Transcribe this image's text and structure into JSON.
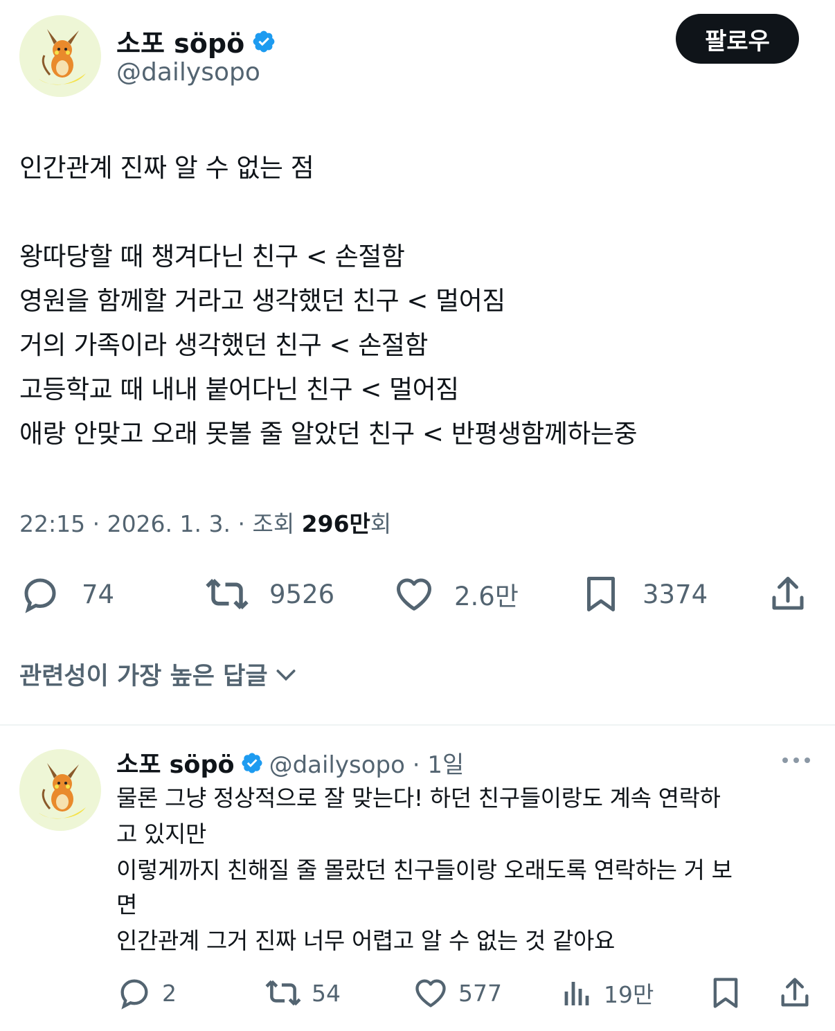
{
  "author": {
    "name": "소포 söpö",
    "handle": "@dailysopo",
    "avatar_icon": "raichu-avatar-icon",
    "verified_icon": "verified-badge-icon"
  },
  "follow_button": {
    "label": "팔로우"
  },
  "tweet": {
    "lines": [
      "인간관계 진짜 알 수 없는 점",
      "왕따당할 때 챙겨다닌 친구 < 손절함",
      "영원을 함께할 거라고 생각했던 친구 < 멀어짐",
      "거의 가족이라 생각했던 친구 < 손절함",
      "고등학교 때 내내 붙어다닌 친구 < 멀어짐",
      "애랑 안맞고 오래 못볼 줄 알았던 친구 < 반평생함께하는중"
    ],
    "time": "22:15 · 2026. 1. 3. · 조회 ",
    "views_bold": "296만",
    "views_suffix": "회"
  },
  "actions": {
    "replies": "74",
    "retweets": "9526",
    "likes": "2.6만",
    "bookmarks": "3374"
  },
  "sort": {
    "label": "관련성이 가장 높은 답글"
  },
  "reply": {
    "name": "소포 söpö",
    "handle_time": "@dailysopo · 1일",
    "lines": [
      "물론 그냥 정상적으로 잘 맞는다! 하던 친구들이랑도 계속 연락하",
      "고 있지만",
      "이렇게까지 친해질 줄 몰랐던 친구들이랑 오래도록 연락하는 거 보",
      "면",
      "인간관계 그거 진짜 너무 어렵고 알 수 없는 것 같아요"
    ],
    "actions": {
      "replies": "2",
      "retweets": "54",
      "likes": "577",
      "views": "19만"
    }
  },
  "colors": {
    "text": "#0f1419",
    "secondary": "#536471",
    "verified": "#1d9bf0",
    "divider": "#eff3f4"
  }
}
